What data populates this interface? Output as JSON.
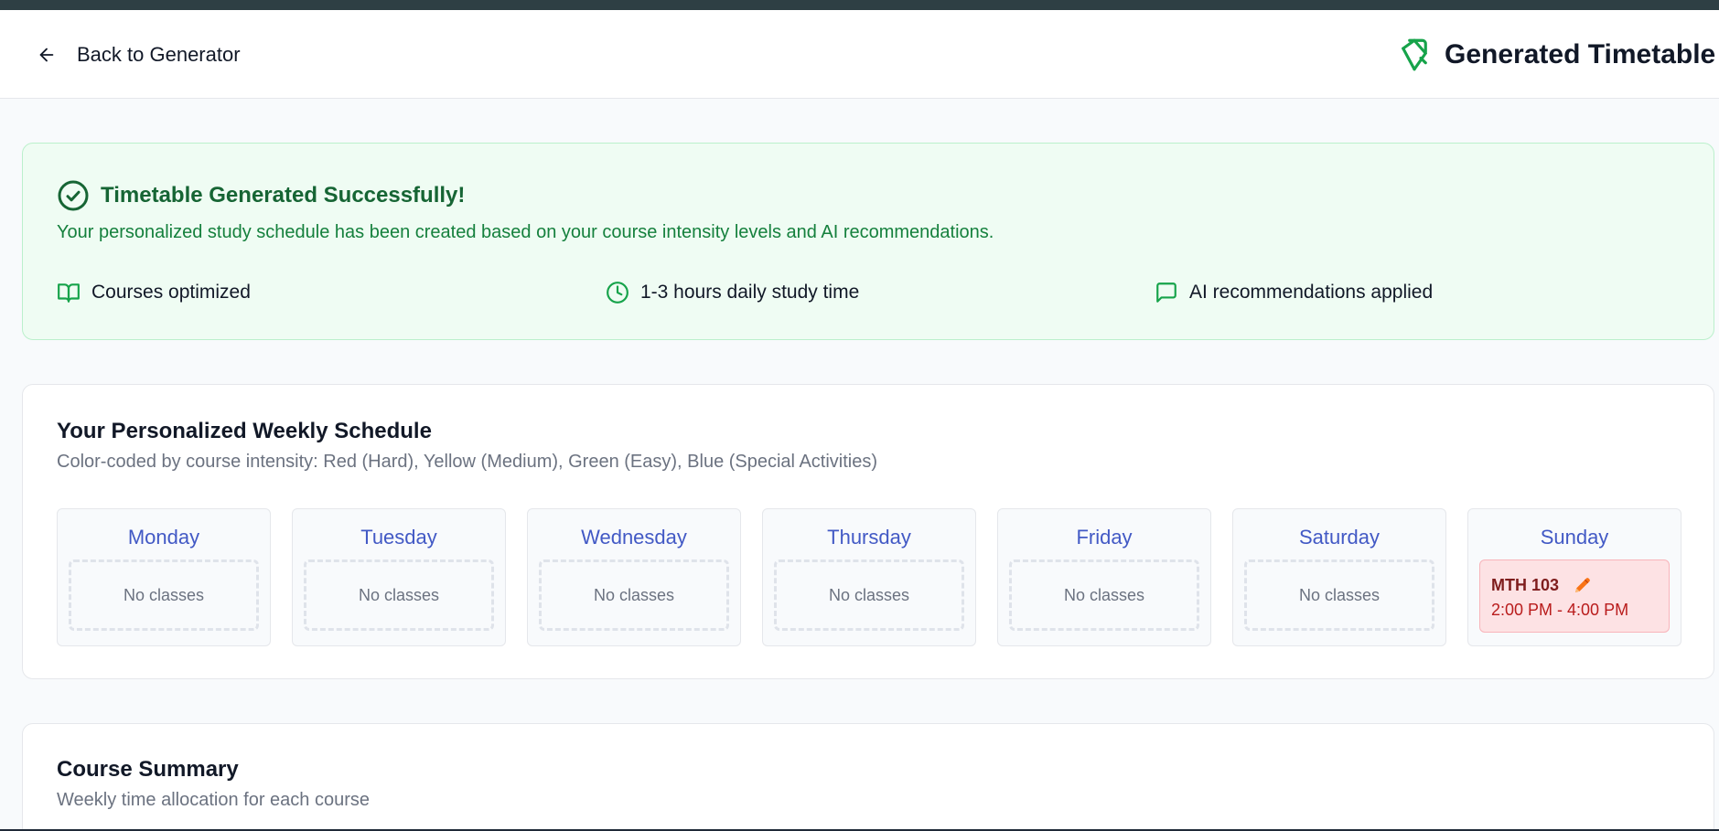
{
  "header": {
    "back_label": "Back to Generator",
    "title": "Generated Timetable"
  },
  "success": {
    "title": "Timetable Generated Successfully!",
    "description": "Your personalized study schedule has been created based on your course intensity levels and AI recommendations.",
    "features": [
      {
        "icon": "book-open-icon",
        "label": "Courses optimized"
      },
      {
        "icon": "clock-icon",
        "label": "1-3 hours daily study time"
      },
      {
        "icon": "message-square-icon",
        "label": "AI recommendations applied"
      }
    ]
  },
  "schedule": {
    "title": "Your Personalized Weekly Schedule",
    "subtitle": "Color-coded by course intensity: Red (Hard), Yellow (Medium), Green (Easy), Blue (Special Activities)",
    "empty_label": "No classes",
    "days": [
      {
        "name": "Monday",
        "classes": []
      },
      {
        "name": "Tuesday",
        "classes": []
      },
      {
        "name": "Wednesday",
        "classes": []
      },
      {
        "name": "Thursday",
        "classes": []
      },
      {
        "name": "Friday",
        "classes": []
      },
      {
        "name": "Saturday",
        "classes": []
      },
      {
        "name": "Sunday",
        "classes": [
          {
            "code": "MTH 103",
            "time": "2:00 PM - 4:00 PM",
            "intensity": "Hard"
          }
        ]
      }
    ]
  },
  "summary": {
    "title": "Course Summary",
    "subtitle": "Weekly time allocation for each course"
  },
  "colors": {
    "accent_green": "#16a34a",
    "day_label": "#4259c5",
    "hard_bg": "#fde2e4",
    "hard_text": "#7f1d1d",
    "edit_icon": "#f97316"
  }
}
